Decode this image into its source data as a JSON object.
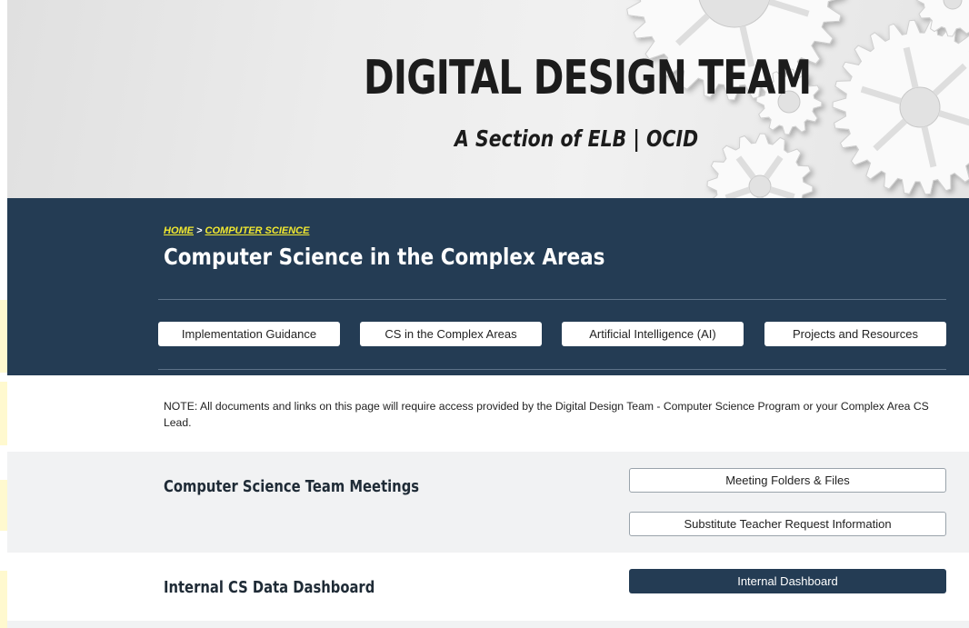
{
  "banner": {
    "title": "DIGITAL DESIGN TEAM",
    "subtitle": "A Section of ELB | OCID",
    "decoration": "gears-icon"
  },
  "breadcrumb": {
    "home": "HOME",
    "separator": " > ",
    "current": "COMPUTER SCIENCE"
  },
  "page_title": "Computer Science in the Complex Areas",
  "nav_buttons": [
    "Implementation Guidance",
    "CS in the Complex Areas",
    "Artificial Intelligence (AI)",
    "Projects and Resources"
  ],
  "note": "NOTE: All documents and links on this page will require access provided by the Digital Design Team - Computer Science Program or your Complex Area CS Lead.",
  "sections": [
    {
      "title": "Computer Science Team Meetings",
      "buttons": [
        "Meeting Folders & Files",
        "Substitute Teacher Request Information"
      ]
    },
    {
      "title": "Internal CS Data Dashboard",
      "buttons": [
        "Internal Dashboard"
      ]
    }
  ],
  "colors": {
    "navy": "#243c54",
    "breadcrumb_link": "#f2e92f",
    "section_bg": "#f1f2f3"
  }
}
